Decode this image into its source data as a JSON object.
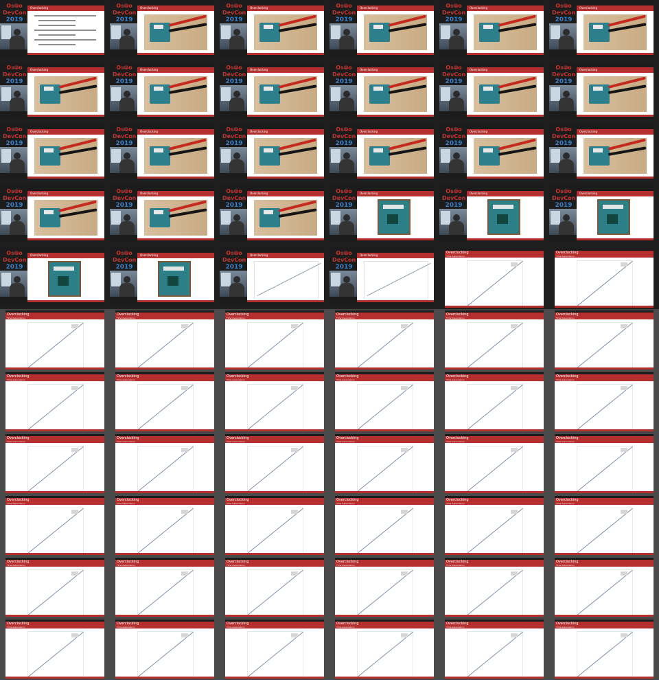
{
  "conference": {
    "logo_line1": "Os⦾o",
    "logo_line2": "DevCon",
    "logo_year": "2019",
    "slide_title": "Overclocking"
  },
  "plot_slide": {
    "title": "Overclocking",
    "subtitle": "Time dependency"
  },
  "colors": {
    "accent_red": "#b42f2e",
    "logo_blue": "#3a7fc6",
    "dark_background": "#1e1e1e",
    "grid_background": "#4a4a4a"
  }
}
